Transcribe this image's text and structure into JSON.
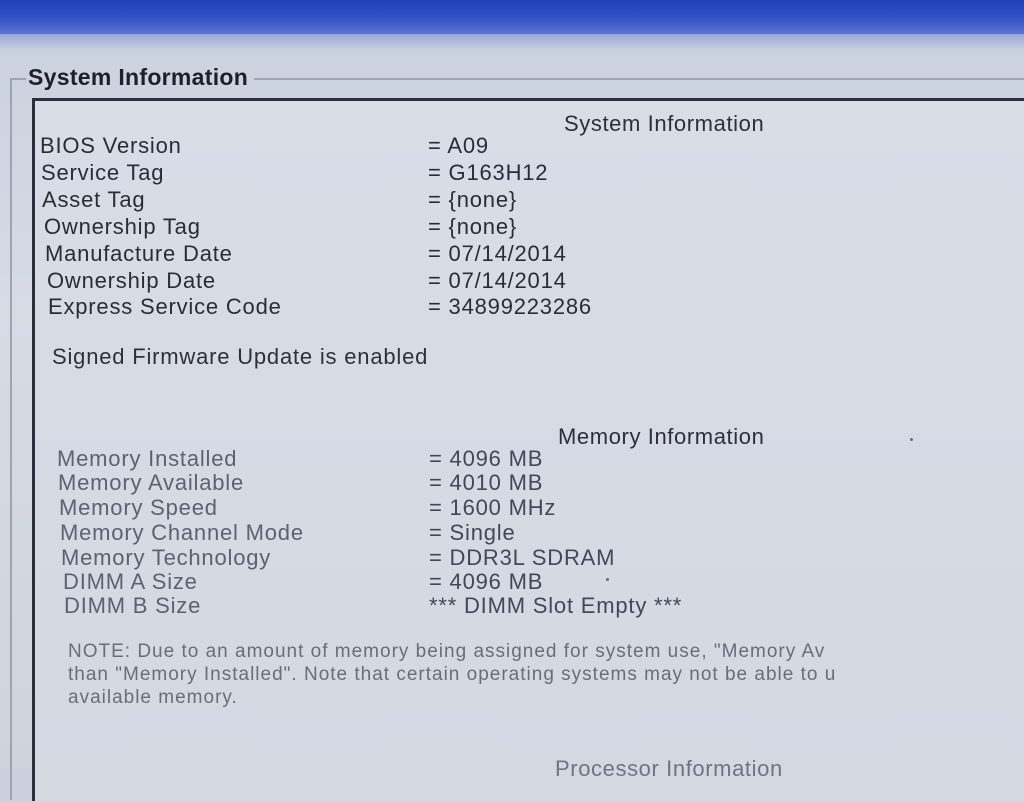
{
  "group": {
    "title": "System Information"
  },
  "system": {
    "heading": "System Information",
    "rows": [
      {
        "label": "BIOS Version",
        "value": "= A09"
      },
      {
        "label": "Service Tag",
        "value": "= G163H12"
      },
      {
        "label": "Asset Tag",
        "value": "= {none}"
      },
      {
        "label": "Ownership Tag",
        "value": "= {none}"
      },
      {
        "label": "Manufacture Date",
        "value": "= 07/14/2014"
      },
      {
        "label": "Ownership Date",
        "value": "= 07/14/2014"
      },
      {
        "label": "Express Service Code",
        "value": "= 34899223286"
      }
    ],
    "signed_firmware": "Signed Firmware Update is enabled"
  },
  "memory": {
    "heading": "Memory Information",
    "rows": [
      {
        "label": "Memory Installed",
        "value": "= 4096 MB"
      },
      {
        "label": "Memory Available",
        "value": "= 4010 MB"
      },
      {
        "label": "Memory Speed",
        "value": "= 1600 MHz"
      },
      {
        "label": "Memory Channel Mode",
        "value": "= Single"
      },
      {
        "label": "Memory Technology",
        "value": "= DDR3L SDRAM"
      },
      {
        "label": "DIMM A Size",
        "value": "= 4096 MB"
      },
      {
        "label": "DIMM B Size",
        "value": "*** DIMM Slot Empty ***"
      }
    ],
    "note_lines": [
      "NOTE: Due to an amount of memory being assigned for system use, \"Memory Av",
      "than \"Memory Installed\". Note that certain operating systems may not be able to u",
      "available memory."
    ]
  },
  "processor": {
    "heading": "Processor Information"
  }
}
